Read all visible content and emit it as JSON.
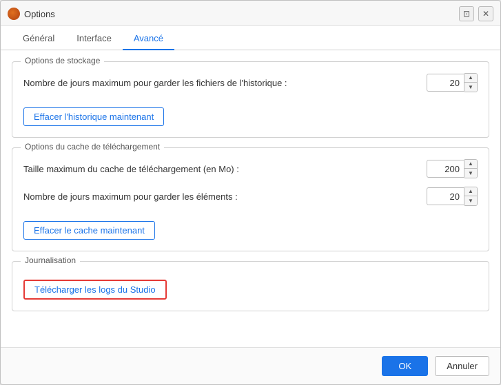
{
  "window": {
    "title": "Options",
    "icon": "options-icon"
  },
  "titlebar": {
    "restore_label": "⊡",
    "close_label": "✕"
  },
  "tabs": [
    {
      "id": "general",
      "label": "Général",
      "active": false
    },
    {
      "id": "interface",
      "label": "Interface",
      "active": false
    },
    {
      "id": "advanced",
      "label": "Avancé",
      "active": true
    }
  ],
  "sections": {
    "storage": {
      "legend": "Options de stockage",
      "history_label": "Nombre de jours maximum pour garder les fichiers de l'historique :",
      "history_value": "20",
      "clear_history_btn": "Effacer l'historique maintenant"
    },
    "cache": {
      "legend": "Options du cache de téléchargement",
      "cache_size_label": "Taille maximum du cache de téléchargement (en Mo) :",
      "cache_size_value": "200",
      "cache_days_label": "Nombre de jours maximum pour garder les éléments :",
      "cache_days_value": "20",
      "clear_cache_btn": "Effacer le cache maintenant"
    },
    "logging": {
      "legend": "Journalisation",
      "download_logs_btn": "Télécharger les logs du Studio"
    }
  },
  "footer": {
    "ok_label": "OK",
    "cancel_label": "Annuler"
  }
}
